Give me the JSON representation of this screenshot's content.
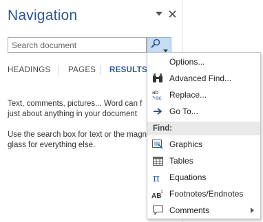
{
  "pane": {
    "title": "Navigation",
    "search_placeholder": "Search document",
    "tabs": [
      "HEADINGS",
      "PAGES",
      "RESULTS"
    ],
    "active_tab": "RESULTS",
    "help_lines": [
      "Text, comments, pictures... Word can find just about anything in your document.",
      "Use the search box for text or the magnifying glass for everything else."
    ],
    "help_visible_1a": "Text, comments, pictures... Word can f",
    "help_visible_1b": "just about anything in your document",
    "help_visible_2a": "Use the search box for text or the magn",
    "help_visible_2b": "glass for everything else."
  },
  "menu": {
    "items_top": [
      {
        "label": "Options...",
        "icon": "none"
      },
      {
        "label": "Advanced Find...",
        "icon": "binoculars-icon"
      },
      {
        "label": "Replace...",
        "icon": "replace-icon"
      },
      {
        "label": "Go To...",
        "icon": "arrow-right-icon"
      }
    ],
    "header": "Find:",
    "items_find": [
      {
        "label": "Graphics",
        "icon": "graphics-icon"
      },
      {
        "label": "Tables",
        "icon": "table-icon"
      },
      {
        "label": "Equations",
        "icon": "pi-icon"
      },
      {
        "label": "Footnotes/Endnotes",
        "icon": "footnote-icon"
      },
      {
        "label": "Comments",
        "icon": "comment-icon"
      }
    ]
  },
  "colors": {
    "title": "#2b579a",
    "search_button": "#c5dcf2",
    "menu_header_bg": "#e9e9e9"
  }
}
